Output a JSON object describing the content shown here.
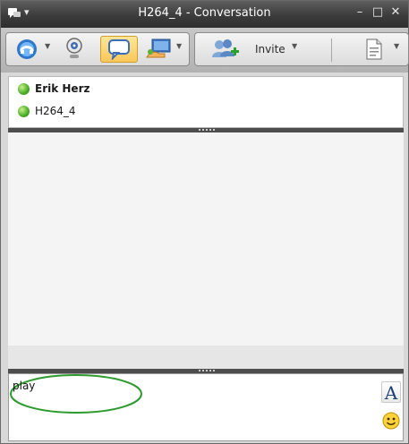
{
  "window": {
    "title": "H264_4 - Conversation"
  },
  "titlebar": {
    "menu_arrow": "▾",
    "minimize_glyph": "–",
    "maximize_glyph": "□",
    "close_glyph": "✕"
  },
  "toolbar": {
    "invite_label": "Invite",
    "dropdown_glyph": "▼"
  },
  "participants": [
    {
      "name": "Erik Herz",
      "status_color": "#4fb12a"
    },
    {
      "name": "H264_4",
      "status_color": "#4fb12a"
    }
  ],
  "input": {
    "value": "play"
  },
  "format": {
    "font_button_label": "A"
  },
  "colors": {
    "titlebar": "#3c3c3c",
    "active_button": "#f8c75a",
    "annotation_ellipse": "#2c9a2c"
  },
  "icons": {
    "app": "messenger-icon",
    "call": "phone-icon",
    "video": "webcam-icon",
    "im": "chat-bubble-icon",
    "share": "share-desktop-icon",
    "invite": "add-people-icon",
    "options": "document-icon",
    "font": "font-icon",
    "emoticon": "smiley-icon"
  }
}
